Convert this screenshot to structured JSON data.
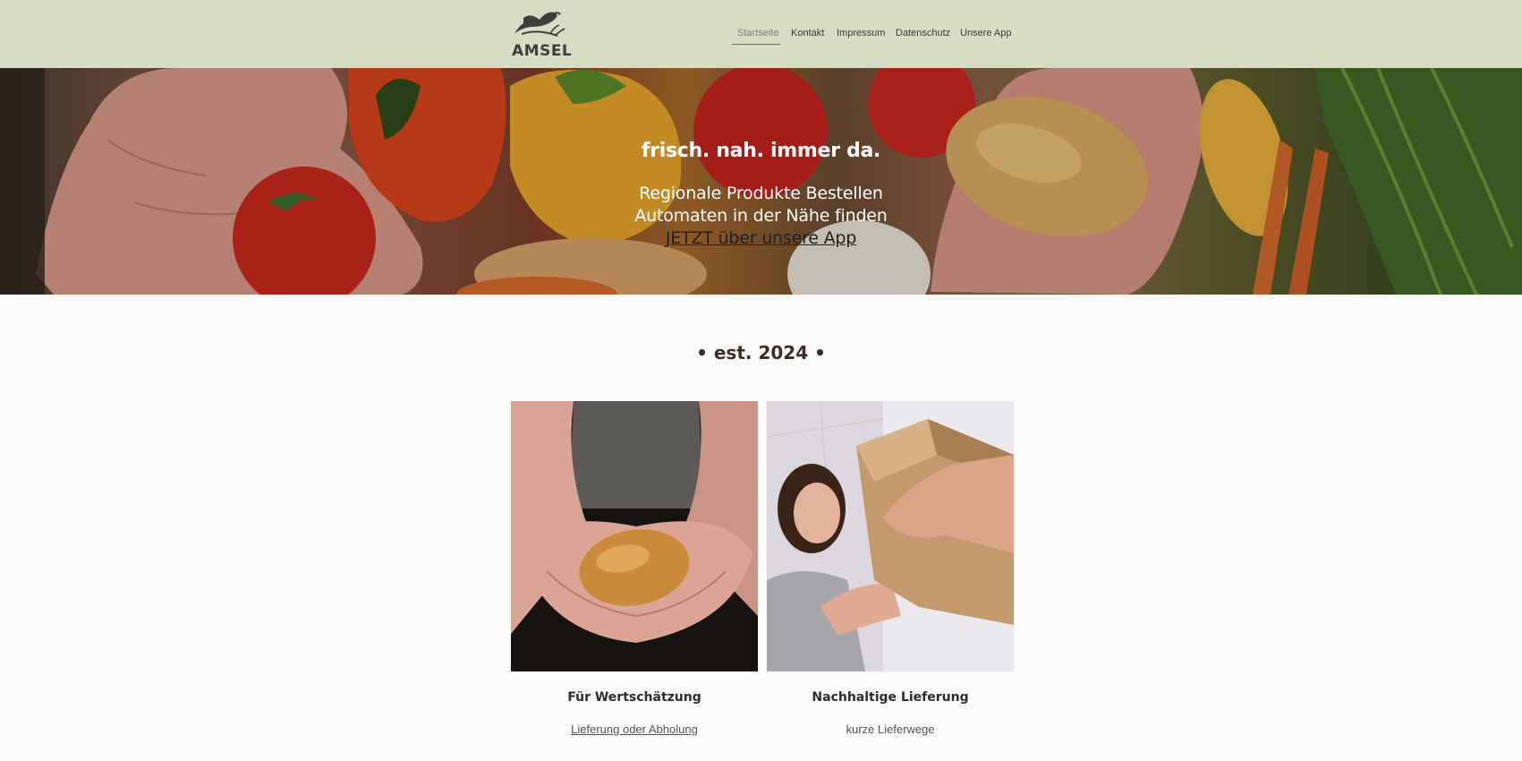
{
  "brand": {
    "name": "AMSEL",
    "logo_icon": "bird-icon"
  },
  "nav": {
    "items": [
      {
        "label": "Startseite",
        "active": true
      },
      {
        "label": "Kontakt",
        "active": false
      },
      {
        "label": "Impressum",
        "active": false
      },
      {
        "label": "Datenschutz",
        "active": false
      },
      {
        "label": "Unsere App",
        "active": false
      }
    ]
  },
  "hero": {
    "title": "frisch. nah. immer da.",
    "line1": "Regionale Produkte Bestellen",
    "line2": "Automaten in der Nähe finden",
    "link": "JETZT über unsere App"
  },
  "est": "• est. 2024 •",
  "cards": [
    {
      "title": "Für Wertschätzung",
      "subtitle": "Lieferung oder Abholung",
      "subtitle_is_link": true
    },
    {
      "title": "Nachhaltige Lieferung",
      "subtitle": "kurze Lieferwege",
      "subtitle_is_link": false
    }
  ],
  "colors": {
    "header_bg": "#d7ddc3",
    "page_bg": "#fafafa",
    "text": "#2d2d2d"
  }
}
